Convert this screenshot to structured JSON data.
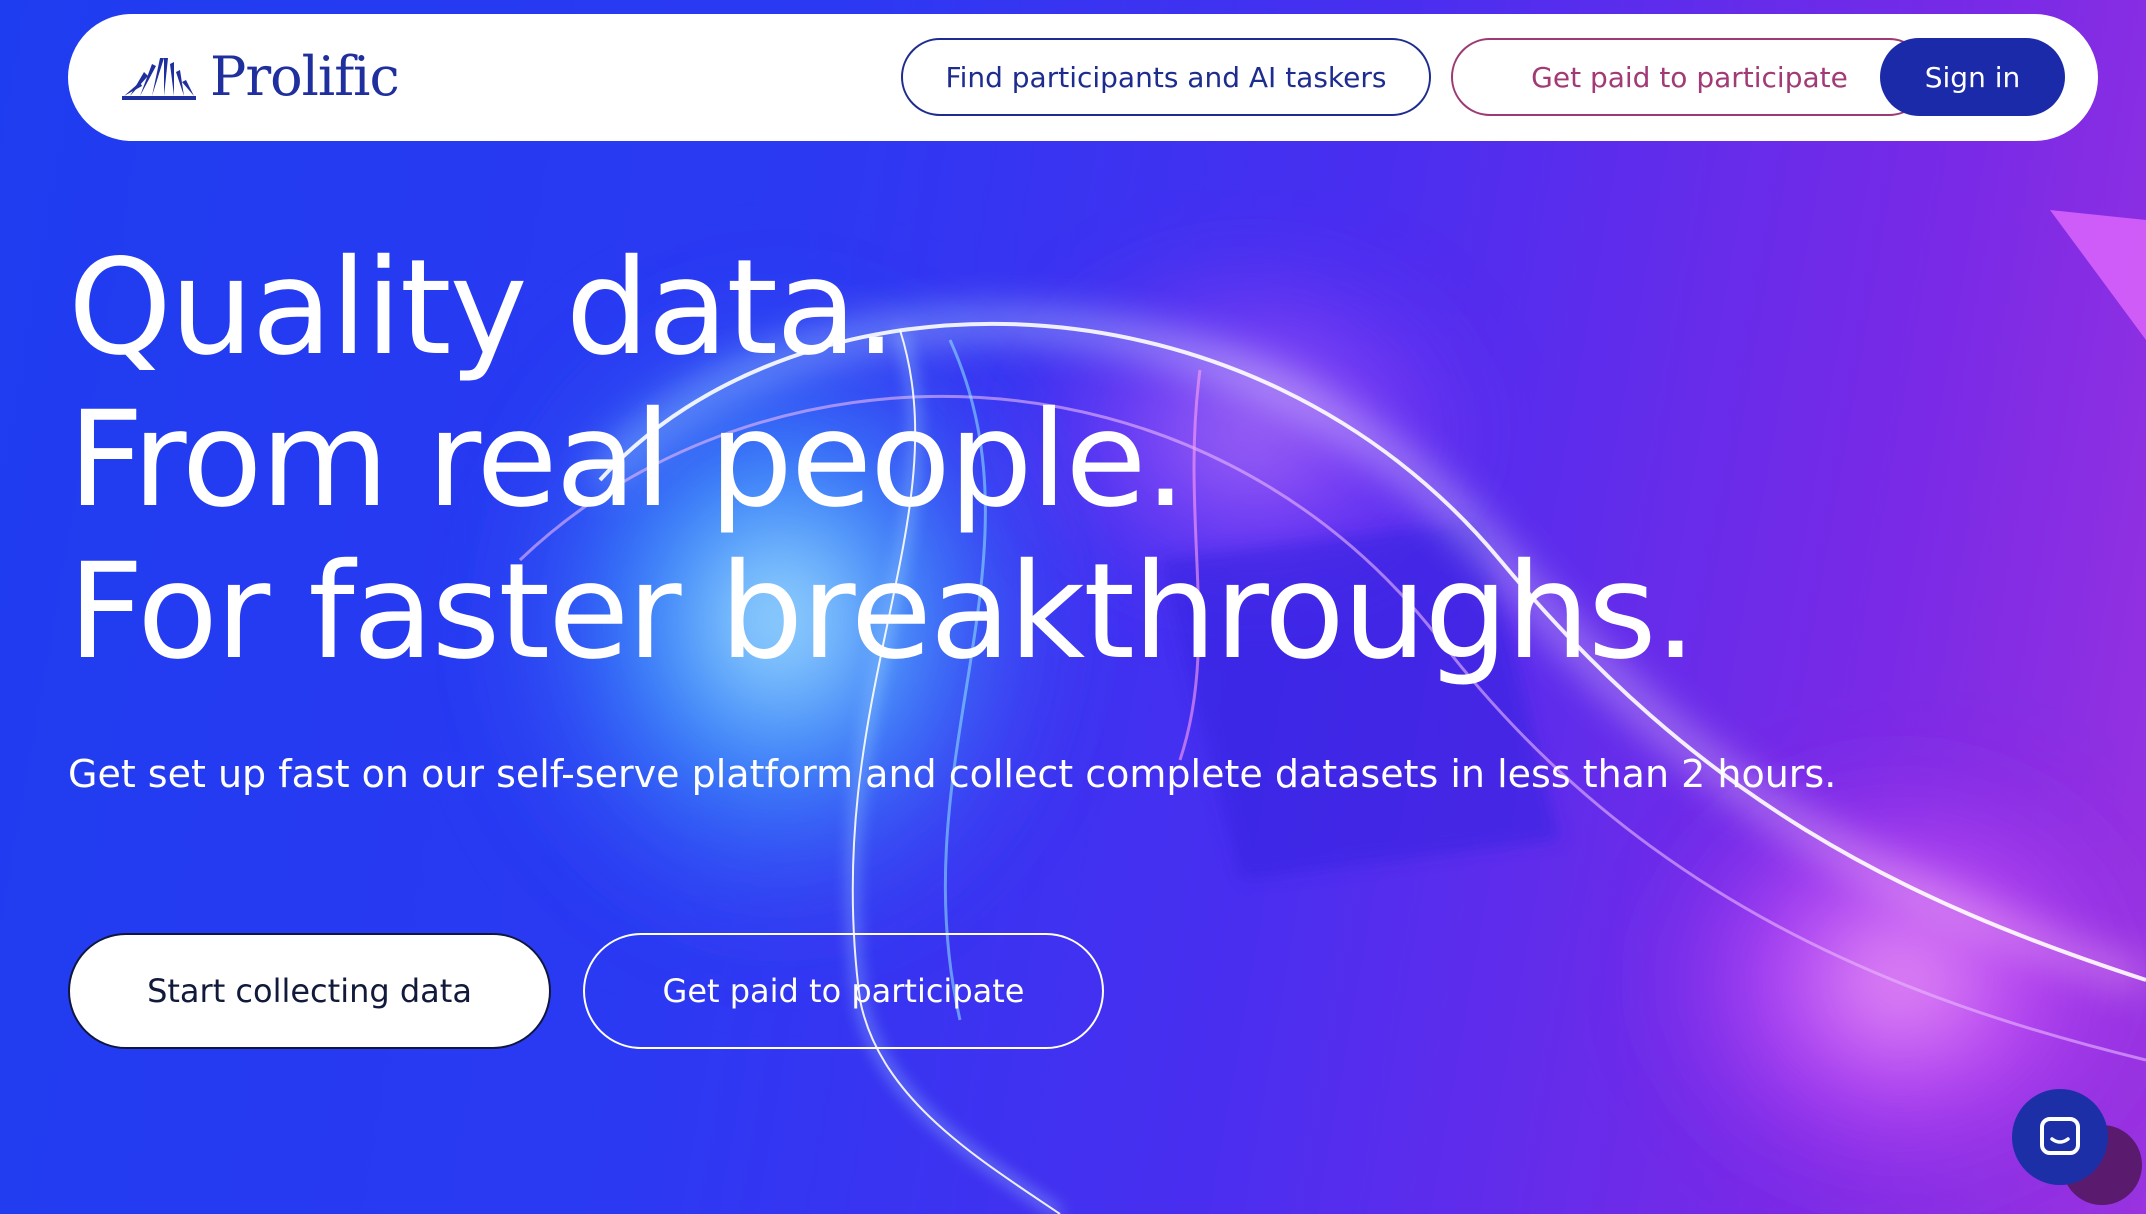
{
  "brand": {
    "name": "Prolific",
    "color": "#1f2f9e"
  },
  "nav": {
    "find_label": "Find participants and AI taskers",
    "paid_label": "Get paid to participate",
    "signin_label": "Sign in"
  },
  "hero": {
    "title_lines": [
      "Quality data.",
      "From real people.",
      "For faster breakthroughs."
    ],
    "subtitle": "Get set up fast on our self-serve platform and collect complete datasets in less than 2 hours.",
    "primary_cta": "Start collecting data",
    "secondary_cta": "Get paid to participate"
  },
  "chat": {
    "icon": "chat-icon"
  },
  "colors": {
    "accent": "#1b2aa8",
    "paid_accent": "#a23a75",
    "background_start": "#1f3df0",
    "background_end": "#9a33e0"
  }
}
